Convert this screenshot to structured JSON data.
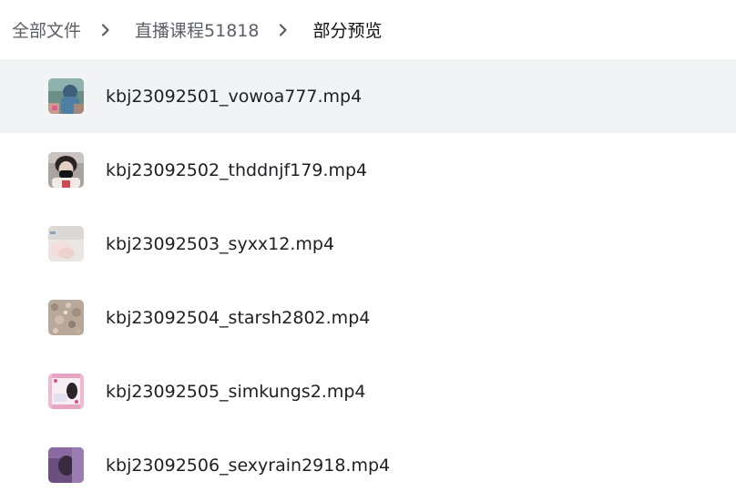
{
  "breadcrumb": {
    "items": [
      {
        "label": "全部文件"
      },
      {
        "label": "直播课程51818"
      },
      {
        "label": "部分预览"
      }
    ]
  },
  "files": [
    {
      "name": "kbj23092501_vowoa777.mp4",
      "thumb_icon": "video-thumbnail-icon",
      "selected": true
    },
    {
      "name": "kbj23092502_thddnjf179.mp4",
      "thumb_icon": "video-thumbnail-icon",
      "selected": false
    },
    {
      "name": "kbj23092503_syxx12.mp4",
      "thumb_icon": "video-thumbnail-icon",
      "selected": false
    },
    {
      "name": "kbj23092504_starsh2802.mp4",
      "thumb_icon": "video-thumbnail-icon",
      "selected": false
    },
    {
      "name": "kbj23092505_simkungs2.mp4",
      "thumb_icon": "video-thumbnail-icon",
      "selected": false
    },
    {
      "name": "kbj23092506_sexyrain2918.mp4",
      "thumb_icon": "video-thumbnail-icon",
      "selected": false
    }
  ],
  "colors": {
    "selected_row_bg": "#f2f3f5",
    "crumb_text": "#5c5e66",
    "current_crumb_text": "#111216"
  }
}
